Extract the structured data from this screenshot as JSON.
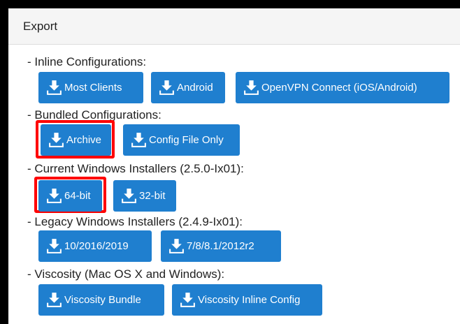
{
  "panel": {
    "title": "Export"
  },
  "sections": {
    "inline": {
      "label": "- Inline Configurations:",
      "buttons": [
        "Most Clients",
        "Android",
        "OpenVPN Connect (iOS/Android)"
      ]
    },
    "bundled": {
      "label": "- Bundled Configurations:",
      "buttons": [
        "Archive",
        "Config File Only"
      ]
    },
    "current_windows": {
      "label": "- Current Windows Installers (2.5.0-Ix01):",
      "buttons": [
        "64-bit",
        "32-bit"
      ]
    },
    "legacy_windows": {
      "label": "- Legacy Windows Installers (2.4.9-Ix01):",
      "buttons": [
        "10/2016/2019",
        "7/8/8.1/2012r2"
      ]
    },
    "viscosity": {
      "label": "- Viscosity (Mac OS X and Windows):",
      "buttons": [
        "Viscosity Bundle",
        "Viscosity Inline Config"
      ]
    }
  },
  "highlighted": [
    "Archive",
    "64-bit"
  ],
  "icon": "download-icon",
  "colors": {
    "button_bg": "#1f7fcf",
    "highlight": "#ff0000",
    "header_bg": "#f5f5f5",
    "border": "#000000"
  }
}
